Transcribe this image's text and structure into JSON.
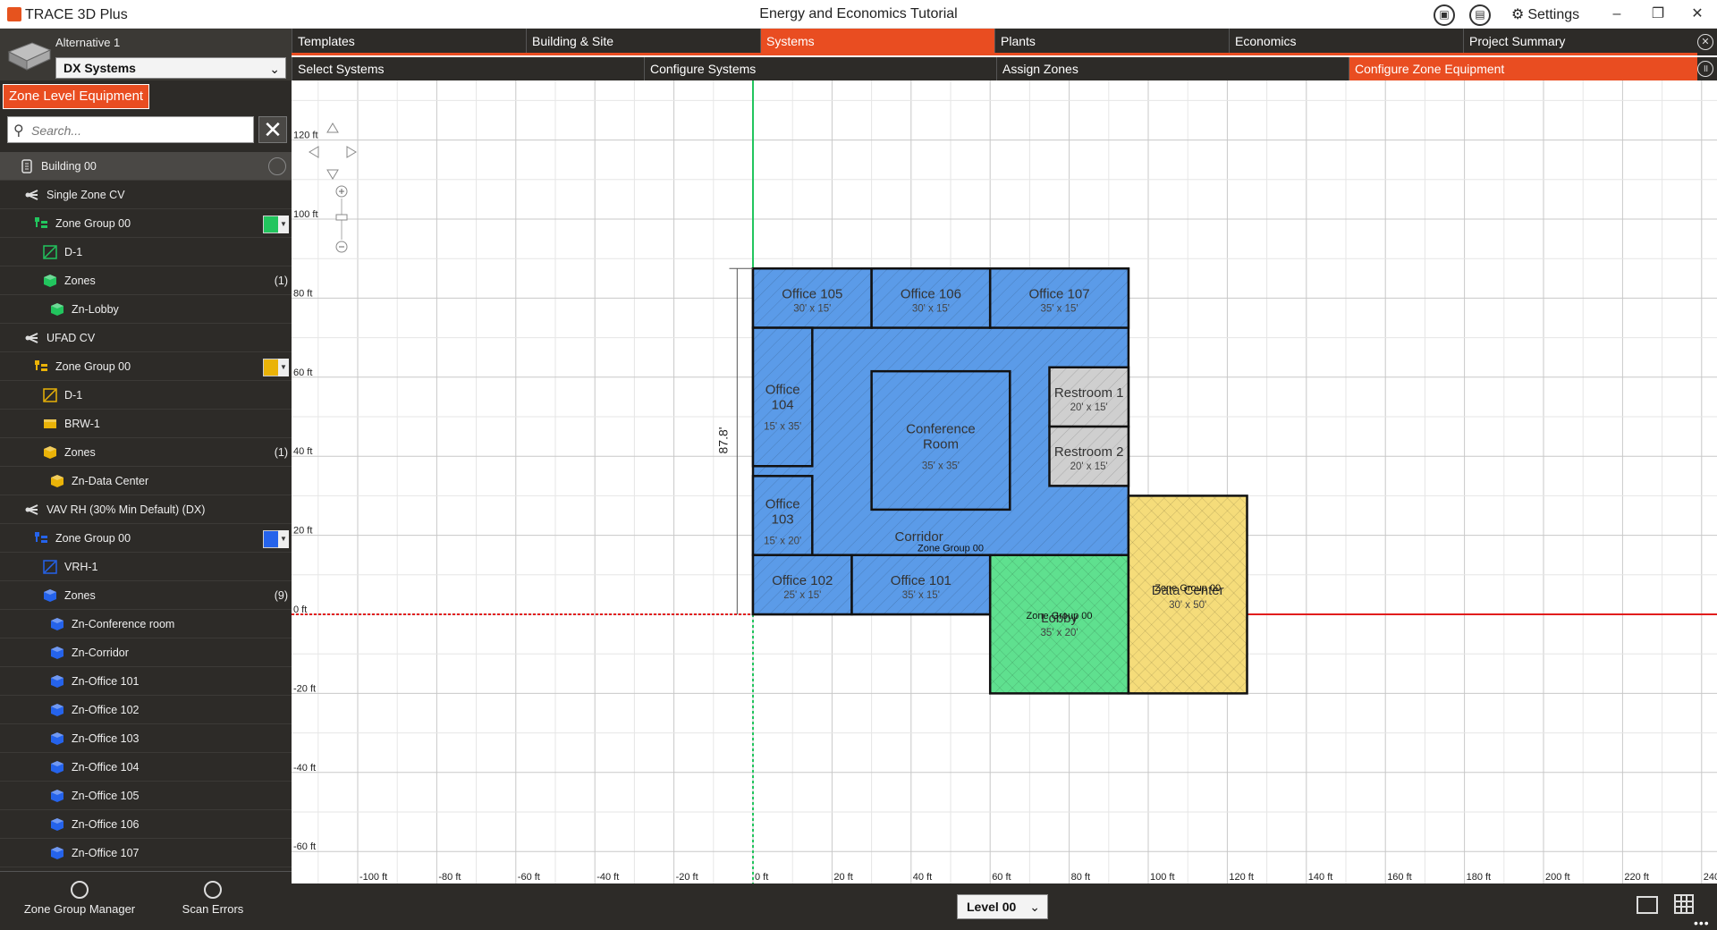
{
  "app": {
    "name": "TRACE 3D Plus",
    "window_title": "Energy and Economics Tutorial",
    "settings_label": "Settings"
  },
  "left_panel": {
    "alternative_label": "Alternative 1",
    "system_selected": "DX Systems",
    "zone_level_button": "Zone Level Equipment",
    "search_placeholder": "Search...",
    "tree": [
      {
        "label": "Building 00",
        "icon": "building-icon",
        "level": 0
      },
      {
        "label": "Single Zone  CV",
        "icon": "system-icon",
        "level": 1
      },
      {
        "label": "Zone Group 00",
        "icon": "zone-group-icon",
        "level": 2,
        "color": "#22c55e"
      },
      {
        "label": "D-1",
        "icon": "diffuser-icon",
        "level": 3,
        "color": "#22c55e"
      },
      {
        "label": "Zones",
        "icon": "zones-icon",
        "level": 3,
        "count": "(1)",
        "color": "#22c55e"
      },
      {
        "label": "Zn-Lobby",
        "icon": "zone-icon",
        "level": 4,
        "color": "#22c55e"
      },
      {
        "label": "UFAD CV",
        "icon": "system-icon",
        "level": 1
      },
      {
        "label": "Zone Group 00",
        "icon": "zone-group-icon",
        "level": 2,
        "color": "#eab308"
      },
      {
        "label": "D-1",
        "icon": "diffuser-icon",
        "level": 3,
        "color": "#eab308"
      },
      {
        "label": "BRW-1",
        "icon": "equipment-icon",
        "level": 3,
        "color": "#eab308"
      },
      {
        "label": "Zones",
        "icon": "zones-icon",
        "level": 3,
        "count": "(1)",
        "color": "#eab308"
      },
      {
        "label": "Zn-Data Center",
        "icon": "zone-icon",
        "level": 4,
        "color": "#eab308"
      },
      {
        "label": "VAV RH (30% Min Default) (DX)",
        "icon": "system-icon",
        "level": 1
      },
      {
        "label": "Zone Group 00",
        "icon": "zone-group-icon",
        "level": 2,
        "color": "#2563eb"
      },
      {
        "label": "VRH-1",
        "icon": "diffuser-icon",
        "level": 3,
        "color": "#2563eb"
      },
      {
        "label": "Zones",
        "icon": "zones-icon",
        "level": 3,
        "count": "(9)",
        "color": "#2563eb"
      },
      {
        "label": "Zn-Conference room",
        "icon": "zone-icon",
        "level": 4,
        "color": "#2563eb"
      },
      {
        "label": "Zn-Corridor",
        "icon": "zone-icon",
        "level": 4,
        "color": "#2563eb"
      },
      {
        "label": "Zn-Office 101",
        "icon": "zone-icon",
        "level": 4,
        "color": "#2563eb"
      },
      {
        "label": "Zn-Office 102",
        "icon": "zone-icon",
        "level": 4,
        "color": "#2563eb"
      },
      {
        "label": "Zn-Office 103",
        "icon": "zone-icon",
        "level": 4,
        "color": "#2563eb"
      },
      {
        "label": "Zn-Office 104",
        "icon": "zone-icon",
        "level": 4,
        "color": "#2563eb"
      },
      {
        "label": "Zn-Office 105",
        "icon": "zone-icon",
        "level": 4,
        "color": "#2563eb"
      },
      {
        "label": "Zn-Office 106",
        "icon": "zone-icon",
        "level": 4,
        "color": "#2563eb"
      },
      {
        "label": "Zn-Office 107",
        "icon": "zone-icon",
        "level": 4,
        "color": "#2563eb"
      }
    ],
    "bottom_tools": {
      "zone_group_manager": "Zone Group Manager",
      "scan_errors": "Scan Errors"
    }
  },
  "tabs_primary": [
    {
      "label": "Templates",
      "active": false
    },
    {
      "label": "Building & Site",
      "active": false
    },
    {
      "label": "Systems",
      "active": true
    },
    {
      "label": "Plants",
      "active": false
    },
    {
      "label": "Economics",
      "active": false
    },
    {
      "label": "Project Summary",
      "active": false
    }
  ],
  "tabs_secondary": [
    {
      "label": "Select Systems",
      "active": false
    },
    {
      "label": "Configure Systems",
      "active": false
    },
    {
      "label": "Assign Zones",
      "active": false
    },
    {
      "label": "Configure Zone Equipment",
      "active": true
    }
  ],
  "floor_plan": {
    "x_ticks": [
      "-100 ft",
      "-80 ft",
      "-60 ft",
      "-40 ft",
      "-20 ft",
      "0 ft",
      "20 ft",
      "40 ft",
      "60 ft",
      "80 ft",
      "100 ft",
      "120 ft",
      "140 ft",
      "160 ft",
      "180 ft",
      "200 ft",
      "220 ft",
      "240"
    ],
    "y_ticks": [
      "120 ft",
      "100 ft",
      "80 ft",
      "60 ft",
      "40 ft",
      "20 ft",
      "0 ft",
      "-20 ft",
      "-40 ft",
      "-60 ft"
    ],
    "dimension_label": "87.8'",
    "zone_group_label": "Zone Group 00",
    "rooms": [
      {
        "name": "Office 105",
        "dims": "30' x 15'"
      },
      {
        "name": "Office 106",
        "dims": "30' x 15'"
      },
      {
        "name": "Office 107",
        "dims": "35' x 15'"
      },
      {
        "name": "Office 104",
        "dims": "15' x 35'"
      },
      {
        "name": "Conference Room",
        "dims": "35' x 35'"
      },
      {
        "name": "Restroom 1",
        "dims": "20' x 15'"
      },
      {
        "name": "Restroom 2",
        "dims": "20' x 15'"
      },
      {
        "name": "Office 103",
        "dims": "15' x 20'"
      },
      {
        "name": "Corridor",
        "dims": ""
      },
      {
        "name": "Office 102",
        "dims": "25' x 15'"
      },
      {
        "name": "Office 101",
        "dims": "35' x 15'"
      },
      {
        "name": "Lobby",
        "dims": "35' x 20'"
      },
      {
        "name": "Data Center",
        "dims": "30' x 50'"
      }
    ],
    "colors": {
      "blue_zone": "#5b9be8",
      "green_zone": "#5fe08f",
      "yellow_zone": "#f5dc7a",
      "restroom": "#cfcfcf",
      "accent": "#e94d21"
    }
  },
  "status_bar": {
    "level_selected": "Level 00"
  }
}
